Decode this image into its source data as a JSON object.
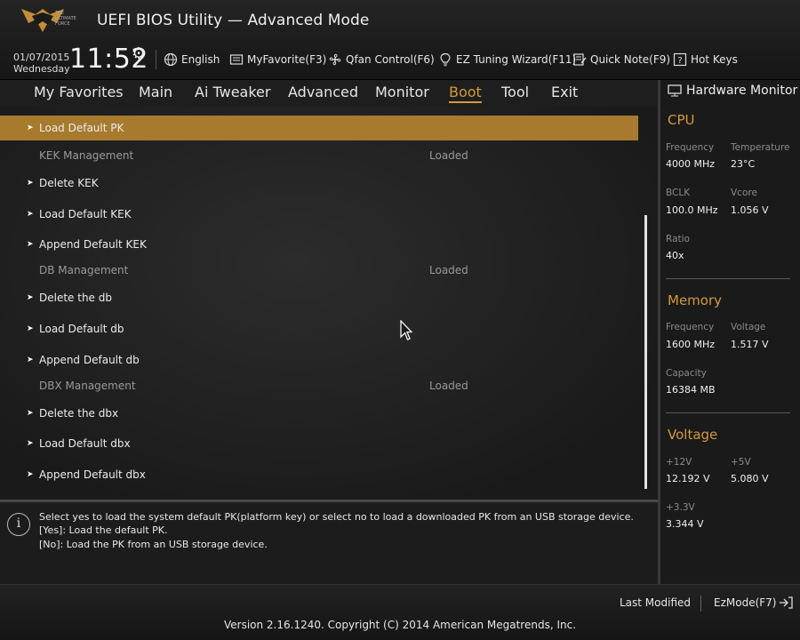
{
  "header": {
    "title": "UEFI BIOS Utility — Advanced Mode",
    "logo_lines": [
      "THE",
      "ULTIMATE",
      "FORCE"
    ],
    "date": "01/07/2015",
    "weekday": "Wednesday",
    "time": "11:52",
    "toolbar": [
      {
        "label": "English",
        "icon": "globe-icon"
      },
      {
        "label": "MyFavorite(F3)",
        "icon": "favorite-icon"
      },
      {
        "label": "Qfan Control(F6)",
        "icon": "fan-icon"
      },
      {
        "label": "EZ Tuning Wizard(F11)",
        "icon": "bulb-icon"
      },
      {
        "label": "Quick Note(F9)",
        "icon": "note-icon"
      },
      {
        "label": "Hot Keys",
        "icon": "question-icon"
      }
    ]
  },
  "nav": {
    "tabs": [
      "My Favorites",
      "Main",
      "Ai Tweaker",
      "Advanced",
      "Monitor",
      "Boot",
      "Tool",
      "Exit"
    ],
    "active": "Boot"
  },
  "list": [
    {
      "label": "Load Default PK",
      "type": "action",
      "selected": true
    },
    {
      "label": "KEK Management",
      "type": "info",
      "value": "Loaded"
    },
    {
      "label": "Delete KEK",
      "type": "action"
    },
    {
      "label": "Load Default KEK",
      "type": "action"
    },
    {
      "label": "Append Default KEK",
      "type": "action"
    },
    {
      "label": "DB Management",
      "type": "info",
      "value": "Loaded"
    },
    {
      "label": "Delete the db",
      "type": "action"
    },
    {
      "label": "Load Default db",
      "type": "action"
    },
    {
      "label": "Append Default db",
      "type": "action"
    },
    {
      "label": "DBX Management",
      "type": "info",
      "value": "Loaded"
    },
    {
      "label": "Delete the dbx",
      "type": "action"
    },
    {
      "label": "Load Default dbx",
      "type": "action"
    },
    {
      "label": "Append Default dbx",
      "type": "action"
    }
  ],
  "help": {
    "lines": [
      "Select yes to load the system default PK(platform key) or select no to load a downloaded PK from an USB storage device.",
      "[Yes]: Load the default PK.",
      "[No]: Load the PK from an USB storage device."
    ]
  },
  "hardware_monitor": {
    "title": "Hardware Monitor",
    "cpu": {
      "heading": "CPU",
      "frequency_label": "Frequency",
      "frequency": "4000 MHz",
      "temperature_label": "Temperature",
      "temperature": "23°C",
      "bclk_label": "BCLK",
      "bclk": "100.0 MHz",
      "vcore_label": "Vcore",
      "vcore": "1.056 V",
      "ratio_label": "Ratio",
      "ratio": "40x"
    },
    "memory": {
      "heading": "Memory",
      "frequency_label": "Frequency",
      "frequency": "1600 MHz",
      "voltage_label": "Voltage",
      "voltage": "1.517 V",
      "capacity_label": "Capacity",
      "capacity": "16384 MB"
    },
    "voltage": {
      "heading": "Voltage",
      "v12_label": "+12V",
      "v12": "12.192 V",
      "v5_label": "+5V",
      "v5": "5.080 V",
      "v33_label": "+3.3V",
      "v33": "3.344 V"
    }
  },
  "footer": {
    "last_modified": "Last Modified",
    "ezmode": "EzMode(F7)",
    "version": "Version 2.16.1240. Copyright (C) 2014 American Megatrends, Inc."
  },
  "colors": {
    "accent": "#d49a3b",
    "selected_row": "#a87a2e"
  }
}
